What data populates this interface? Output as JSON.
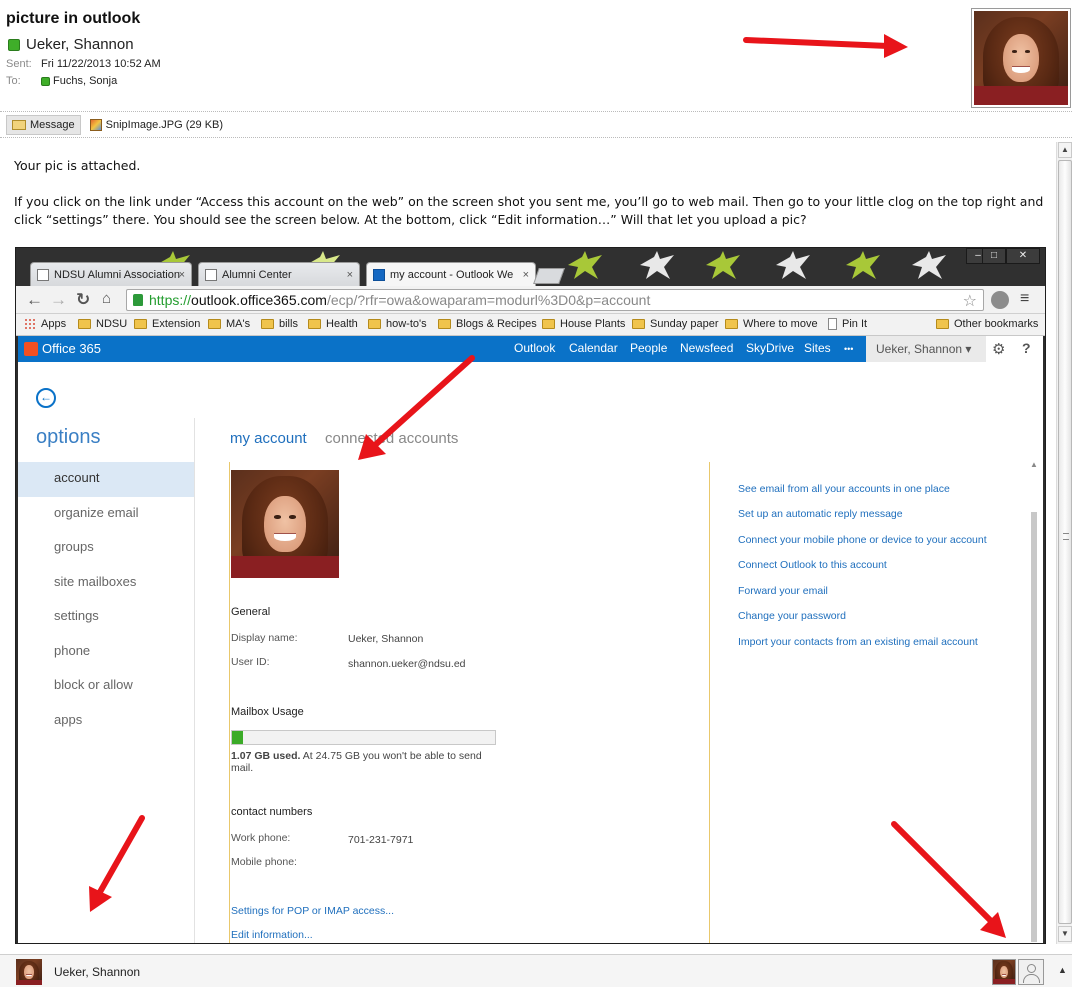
{
  "header": {
    "subject": "picture in outlook",
    "sender": "Ueker, Shannon",
    "sent_label": "Sent:",
    "sent_value": "Fri 11/22/2013 10:52 AM",
    "to_label": "To:",
    "to_value": "Fuchs, Sonja"
  },
  "attachments": {
    "message_tab": "Message",
    "file_tab": "SnipImage.JPG (29 KB)"
  },
  "body": {
    "line1": "Your pic is attached.",
    "line2": "If you click on the link under “Access this account on the web” on the screen shot you sent me, you’ll go to web mail. Then go to your little clog on the top right and click “settings” there.  You should see the screen below. At the bottom, click “Edit information…”  Will that let you upload a pic?"
  },
  "browser": {
    "tabs": [
      {
        "label": "NDSU Alumni Association",
        "close": "×"
      },
      {
        "label": "Alumni Center",
        "close": "×"
      },
      {
        "label": "my account - Outlook We",
        "close": "×"
      }
    ],
    "window_controls": [
      "–",
      "□",
      "✕"
    ],
    "url_scheme": "https://",
    "url_host": "outlook.office365.com",
    "url_rest": "/ecp/?rfr=owa&owaparam=modurl%3D0&p=account",
    "bookmarks": [
      "Apps",
      "NDSU",
      "Extension",
      "MA's",
      "bills",
      "Health",
      "how-to's",
      "Blogs & Recipes",
      "House Plants",
      "Sunday paper",
      "Where to move",
      "Pin It"
    ],
    "other_bookmarks": "Other bookmarks"
  },
  "o365": {
    "logo": "Office 365",
    "nav": [
      "Outlook",
      "Calendar",
      "People",
      "Newsfeed",
      "SkyDrive",
      "Sites",
      "•••"
    ],
    "user": "Ueker, Shannon ▾",
    "gear": "⚙",
    "help": "?"
  },
  "owa": {
    "options_title": "options",
    "left_nav": [
      "account",
      "organize email",
      "groups",
      "site mailboxes",
      "settings",
      "phone",
      "block or allow",
      "apps"
    ],
    "tab_my_account": "my account",
    "tab_connected": "connected accounts",
    "general_heading": "General",
    "display_name_label": "Display name:",
    "display_name_value": "Ueker, Shannon",
    "user_id_label": "User ID:",
    "user_id_value": "shannon.ueker@ndsu.ed",
    "mailbox_heading": "Mailbox Usage",
    "usage_fraction": 0.043,
    "usage_bold": "1.07 GB used.",
    "usage_rest": " At 24.75 GB you won't be able to send mail.",
    "contact_heading": "contact numbers",
    "work_phone_label": "Work phone:",
    "work_phone_value": "701-231-7971",
    "mobile_phone_label": "Mobile phone:",
    "pop_link": "Settings for POP or IMAP access...",
    "edit_link": "Edit information...",
    "right_links": [
      "See email from all your accounts in one place",
      "Set up an automatic reply message",
      "Connect your mobile phone or device to your account",
      "Connect Outlook to this account",
      "Forward your email",
      "Change your password",
      "Import your contacts from an existing email account"
    ]
  },
  "people_pane": {
    "name": "Ueker, Shannon"
  },
  "colors": {
    "o365_blue": "#0a72c8",
    "presence_green": "#3fae29",
    "arrow_red": "#e8141a",
    "usage_green": "#3bab28"
  }
}
